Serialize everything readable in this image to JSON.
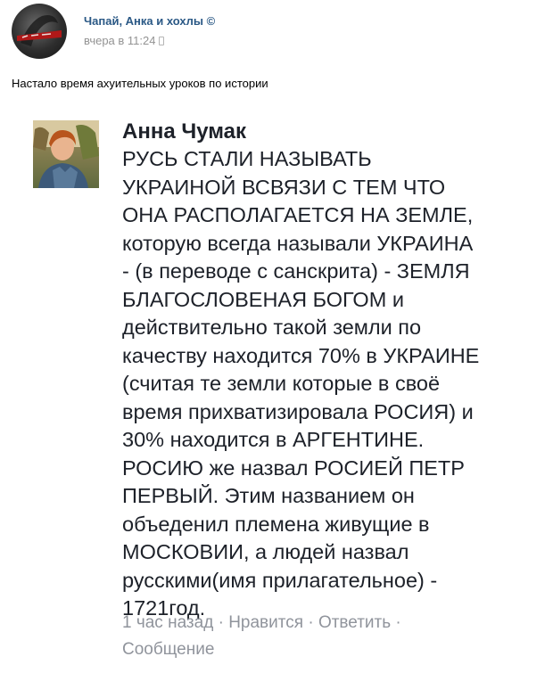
{
  "post": {
    "author": "Чапай, Анка и хохлы ©",
    "time": "вчера в 11:24",
    "text": "Настало время ахуительных уроков по истории"
  },
  "embedded_comment": {
    "author": "Анна Чумак",
    "lines": [
      "РУСЬ СТАЛИ НАЗЫВАТЬ",
      "УКРАИНОЙ ВСВЯЗИ С ТЕМ ЧТО",
      "ОНА РАСПОЛАГАЕТСЯ НА ЗЕМЛЕ,",
      "которую всегда называли УКРАИНА",
      "- (в переводе с санскрита) - ЗЕМЛЯ",
      "БЛАГОСЛОВЕНАЯ БОГОМ и",
      "действительно такой земли по",
      "качеству находится 70% в УКРАИНЕ",
      "(считая те земли которые в своё",
      "время прихватизировала РОСИЯ) и",
      "30% находится в АРГЕНТИНЕ.",
      "РОСИЮ же назвал РОСИЕЙ ПЕТР",
      "ПЕРВЫЙ. Этим названием он",
      "объеденил племена живущие в",
      "МОСКОВИИ, а людей назвал",
      "русскими(имя прилагательное) -",
      "1721год."
    ],
    "meta": {
      "time": "1 час назад",
      "separator": " · ",
      "like": "Нравится",
      "reply": "Ответить",
      "message": "Сообщение"
    }
  }
}
